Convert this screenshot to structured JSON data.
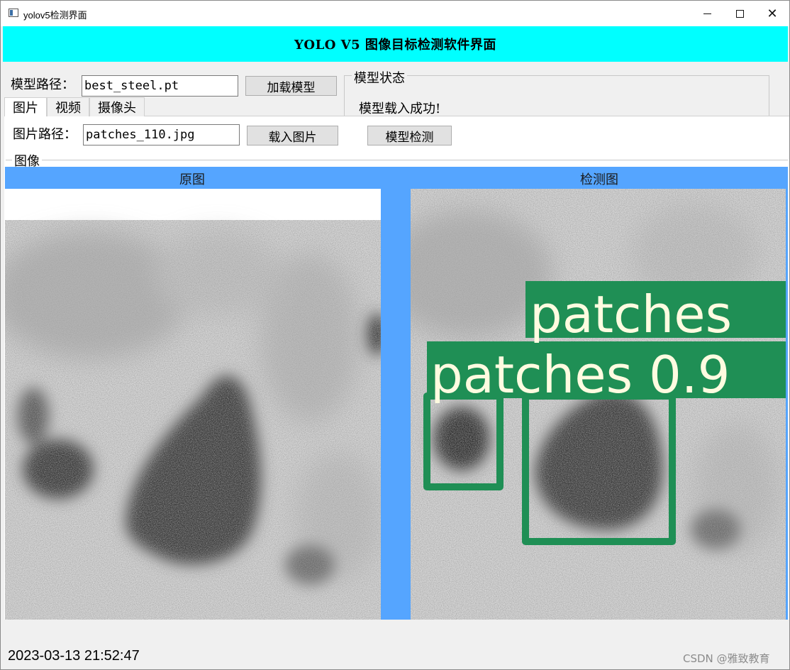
{
  "window": {
    "title": "yolov5检测界面",
    "minimize": "",
    "maximize": "",
    "close": "✕"
  },
  "banner": {
    "title": "YOLO V5 图像目标检测软件界面"
  },
  "model": {
    "path_label": "模型路径：",
    "path_value": "best_steel.pt",
    "load_button": "加载模型",
    "status_title": "模型状态",
    "status_text": "模型载入成功!"
  },
  "tabs": [
    {
      "label": "图片"
    },
    {
      "label": "视频"
    },
    {
      "label": "摄像头"
    }
  ],
  "image_tab": {
    "path_label": "图片路径：",
    "path_value": "patches_110.jpg",
    "load_button": "载入图片",
    "detect_button": "模型检测",
    "group_title": "图像",
    "original_header": "原图",
    "detected_header": "检测图"
  },
  "detections": [
    {
      "label": "patches",
      "confidence": ""
    },
    {
      "label": "patches 0.9",
      "confidence": "0.9"
    }
  ],
  "colors": {
    "banner": "#00ffff",
    "image_area": "#55a5ff",
    "detection_box": "#1f8f55",
    "detection_text": "#fffbe0"
  },
  "statusbar": {
    "timestamp": "2023-03-13 21:52:47",
    "watermark": "CSDN @雅致教育"
  }
}
